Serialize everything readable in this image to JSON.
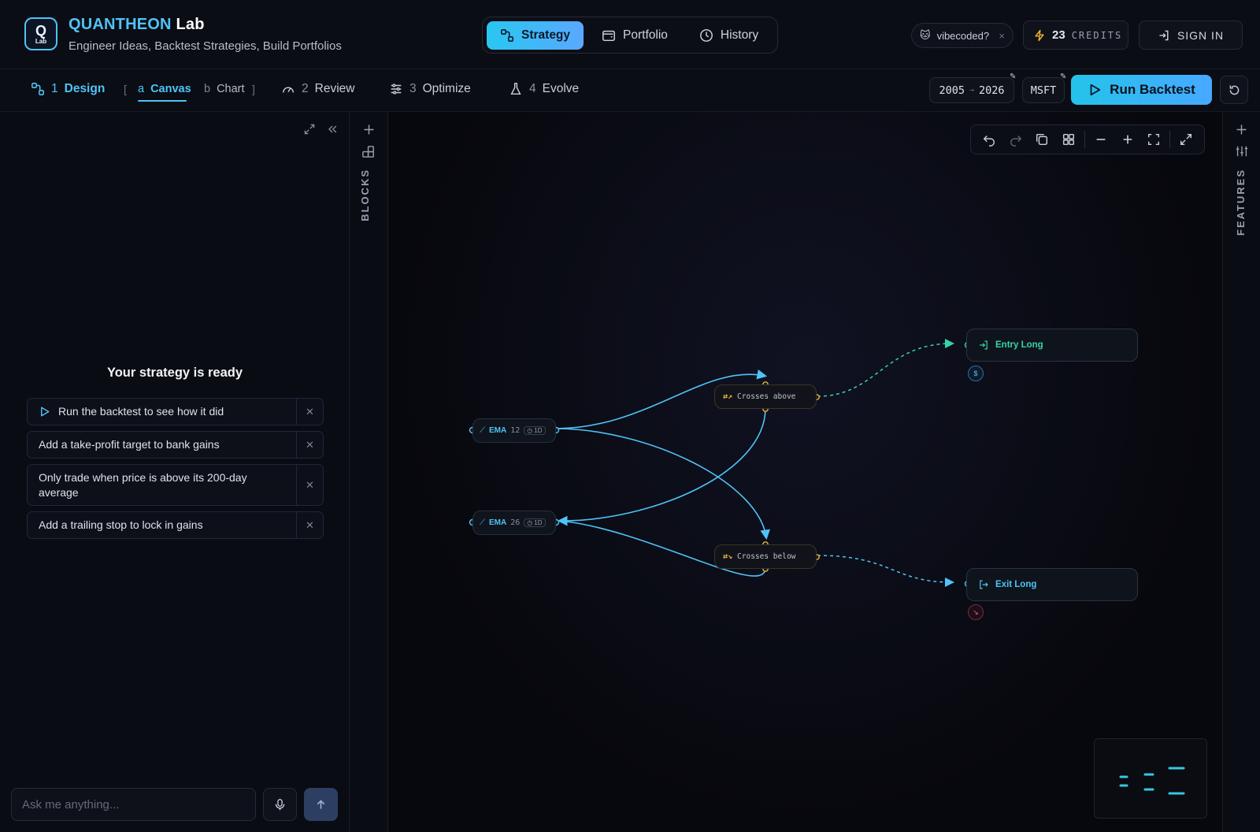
{
  "brand": {
    "name_part1": "QUANTHEON",
    "name_part2": "Lab",
    "logo_letter": "Q",
    "logo_sub": "Lab",
    "tagline": "Engineer Ideas, Backtest Strategies, Build Portfolios"
  },
  "nav": [
    {
      "label": "Strategy",
      "icon": "strategy-icon",
      "active": true
    },
    {
      "label": "Portfolio",
      "icon": "wallet-icon",
      "active": false
    },
    {
      "label": "History",
      "icon": "clock-icon",
      "active": false
    }
  ],
  "vibe_chip": {
    "label": "vibecoded?",
    "icon": "cat-emoji",
    "close": "×"
  },
  "credits": {
    "count": "23",
    "label": "CREDITS"
  },
  "signin": {
    "label": "SIGN IN"
  },
  "steps": [
    {
      "num": "1",
      "label": "Design",
      "active": true
    },
    {
      "num": "2",
      "label": "Review",
      "active": false
    },
    {
      "num": "3",
      "label": "Optimize",
      "active": false
    },
    {
      "num": "4",
      "label": "Evolve",
      "active": false
    }
  ],
  "substeps": [
    {
      "key": "a",
      "label": "Canvas",
      "active": true
    },
    {
      "key": "b",
      "label": "Chart",
      "active": false
    }
  ],
  "brackets": {
    "open": "[",
    "close": "]"
  },
  "date_range": {
    "start": "2005",
    "arrow": "→",
    "end": "2026"
  },
  "ticker": "MSFT",
  "run_backtest": {
    "label": "Run Backtest"
  },
  "left_panel": {
    "title": "Your strategy is ready",
    "suggestions": [
      {
        "text": "Run the backtest to see how it did",
        "has_play": true
      },
      {
        "text": "Add a take-profit target to bank gains",
        "has_play": false
      },
      {
        "text": "Only trade when price is above its 200-day average",
        "has_play": false
      },
      {
        "text": "Add a trailing stop to lock in gains",
        "has_play": false
      }
    ],
    "chat_placeholder": "Ask me anything..."
  },
  "rails": {
    "blocks": "BLOCKS",
    "features": "FEATURES"
  },
  "canvas": {
    "nodes": {
      "ema_fast": {
        "name": "EMA",
        "period": "12",
        "timeframe": "1D"
      },
      "ema_slow": {
        "name": "EMA",
        "period": "26",
        "timeframe": "1D"
      },
      "cross_above": {
        "label": "Crosses above"
      },
      "cross_below": {
        "label": "Crosses below"
      },
      "entry": {
        "label": "Entry Long"
      },
      "exit": {
        "label": "Exit Long"
      }
    },
    "colors": {
      "edge": "#4fc3f7",
      "entry": "#39d3a6",
      "port": "#e8b43c",
      "exit_badge": "#ff5c8a"
    }
  }
}
